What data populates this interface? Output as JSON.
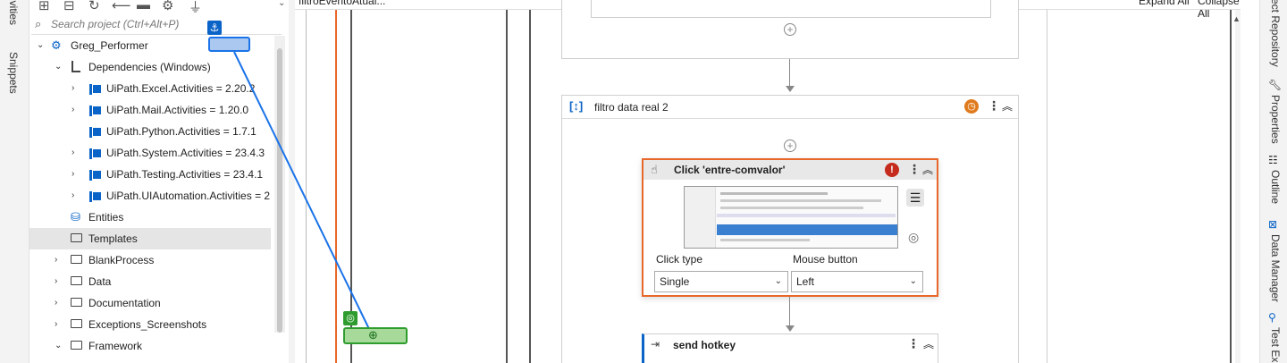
{
  "left_tabs": [
    "ivities",
    "Snippets"
  ],
  "search": {
    "placeholder": "Search project (Ctrl+Alt+P)"
  },
  "tree": {
    "root": "Greg_Performer",
    "dependencies": "Dependencies (Windows)",
    "packages": [
      "UiPath.Excel.Activities = 2.20.2",
      "UiPath.Mail.Activities = 1.20.0",
      "UiPath.Python.Activities = 1.7.1",
      "UiPath.System.Activities = 23.4.3",
      "UiPath.Testing.Activities = 23.4.1",
      "UiPath.UIAutomation.Activities = 2"
    ],
    "entities": "Entities",
    "templates": "Templates",
    "folders": [
      "BlankProcess",
      "Data",
      "Documentation",
      "Exceptions_Screenshots",
      "Framework"
    ]
  },
  "canvas": {
    "breadcrumb": "filtroEventoAtual...",
    "expand_all": "Expand All",
    "collapse_all": "Collapse All",
    "sequence_title": "filtro data real 2",
    "click_title": "Click 'entre-comvalor'",
    "click_type_label": "Click type",
    "click_type_value": "Single",
    "mouse_button_label": "Mouse button",
    "mouse_button_value": "Left",
    "hotkey_title": "send hotkey"
  },
  "right_tabs": [
    "ect Repository",
    "Properties",
    "Outline",
    "Data Manager",
    "Test Ex"
  ],
  "colors": {
    "accent_orange": "#e8672b",
    "anchor_blue": "#0a63c7",
    "target_green": "#2e9d2e",
    "error_red": "#c42b1c"
  }
}
